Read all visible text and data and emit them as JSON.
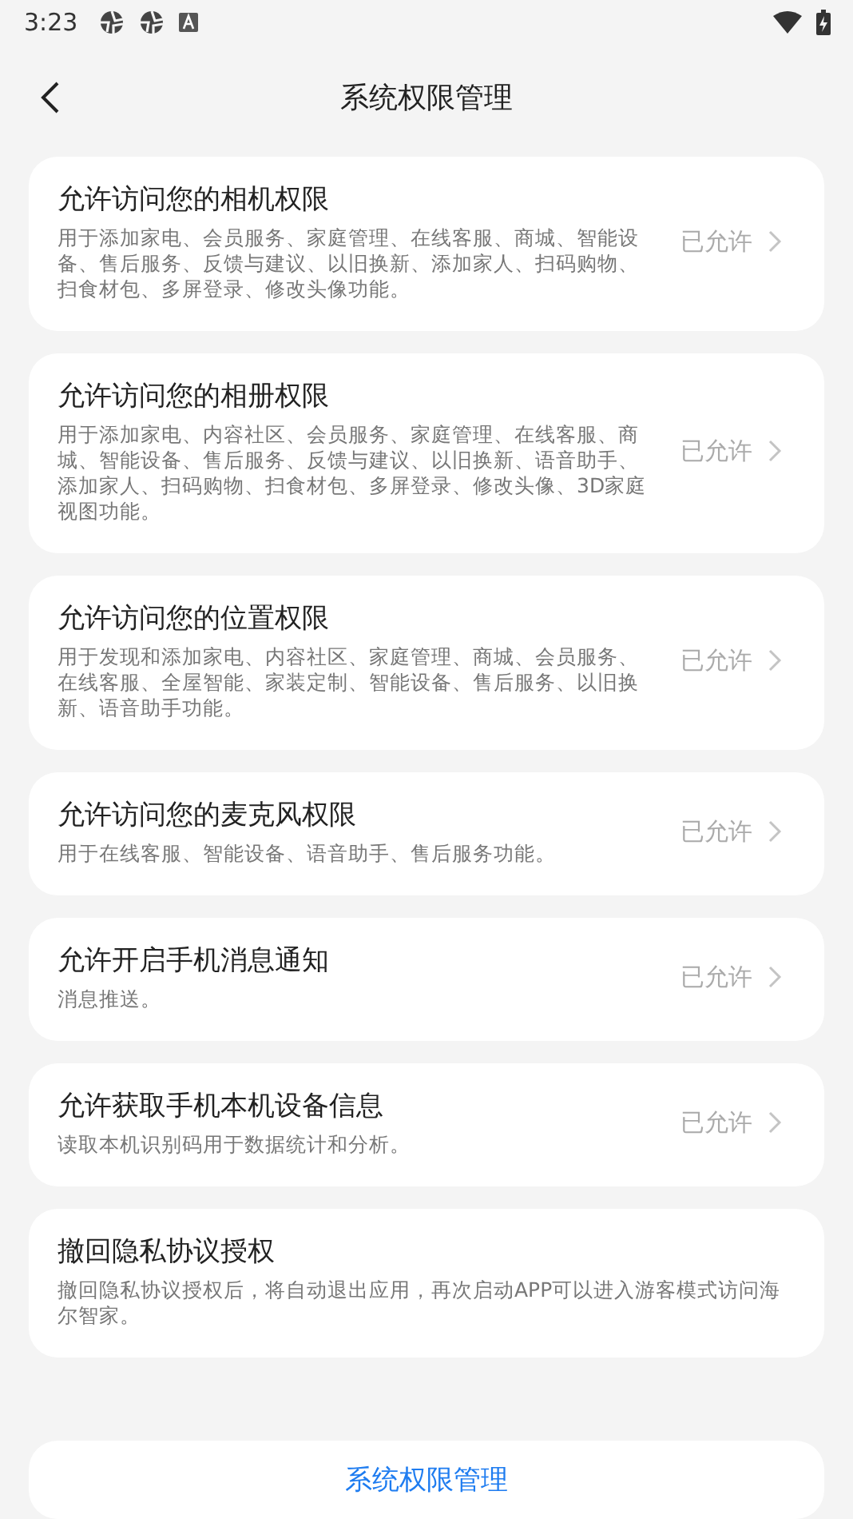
{
  "status_bar": {
    "time": "3:23"
  },
  "header": {
    "title": "系统权限管理"
  },
  "permissions": [
    {
      "title": "允许访问您的相机权限",
      "description": "用于添加家电、会员服务、家庭管理、在线客服、商城、智能设备、售后服务、反馈与建议、以旧换新、添加家人、扫码购物、扫食材包、多屏登录、修改头像功能。",
      "status": "已允许"
    },
    {
      "title": "允许访问您的相册权限",
      "description": "用于添加家电、内容社区、会员服务、家庭管理、在线客服、商城、智能设备、售后服务、反馈与建议、以旧换新、语音助手、添加家人、扫码购物、扫食材包、多屏登录、修改头像、3D家庭视图功能。",
      "status": "已允许"
    },
    {
      "title": "允许访问您的位置权限",
      "description": "用于发现和添加家电、内容社区、家庭管理、商城、会员服务、在线客服、全屋智能、家装定制、智能设备、售后服务、以旧换新、语音助手功能。",
      "status": "已允许"
    },
    {
      "title": "允许访问您的麦克风权限",
      "description": "用于在线客服、智能设备、语音助手、售后服务功能。",
      "status": "已允许"
    },
    {
      "title": "允许开启手机消息通知",
      "description": "消息推送。",
      "status": "已允许"
    },
    {
      "title": "允许获取手机本机设备信息",
      "description": "读取本机识别码用于数据统计和分析。",
      "status": "已允许"
    },
    {
      "title": "撤回隐私协议授权",
      "description": "撤回隐私协议授权后，将自动退出应用，再次启动APP可以进入游客模式访问海尔智家。"
    }
  ],
  "bottom_button": "系统权限管理"
}
